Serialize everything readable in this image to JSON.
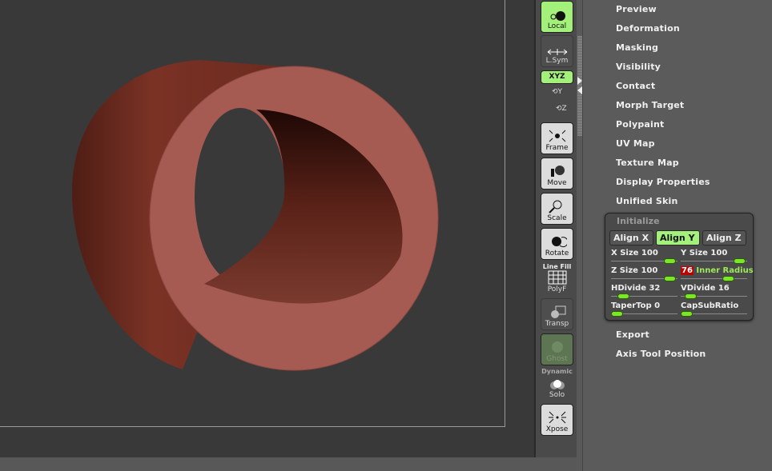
{
  "toolbar": {
    "local": "Local",
    "lsym": "L.Sym",
    "xyz": "XYZ",
    "y": "Y",
    "z": "Z",
    "frame": "Frame",
    "move": "Move",
    "scale": "Scale",
    "rotate": "Rotate",
    "linefill": "Line Fill",
    "polyf": "PolyF",
    "transp": "Transp",
    "ghost": "Ghost",
    "dynamic": "Dynamic",
    "solo": "Solo",
    "xpose": "Xpose"
  },
  "menu": [
    "Preview",
    "Deformation",
    "Masking",
    "Visibility",
    "Contact",
    "Morph Target",
    "Polypaint",
    "UV Map",
    "Texture Map",
    "Display Properties",
    "Unified Skin"
  ],
  "initialize": {
    "title": "Initialize",
    "align": [
      "Align X",
      "Align Y",
      "Align Z"
    ],
    "active_align": "Align Y",
    "sliders": [
      {
        "label": "X Size 100",
        "value": 0.97
      },
      {
        "label": "Y Size 100",
        "value": 0.97
      },
      {
        "label": "Z Size 100",
        "value": 0.97
      },
      {
        "prefix": "76",
        "label": "Inner Radius",
        "value": 0.76
      },
      {
        "label": "HDivide 32",
        "value": 0.12
      },
      {
        "label": "VDivide 16",
        "value": 0.08
      },
      {
        "label": "TaperTop 0",
        "value": 0.0
      },
      {
        "label": "CapSubRatio",
        "value": 0.0
      }
    ]
  },
  "menu_after": [
    "Export",
    "Axis Tool Position"
  ],
  "colors": {
    "accent": "#a3f07a",
    "cylinder_face": "#a55a52",
    "cylinder_body": "#6e2a1f"
  }
}
